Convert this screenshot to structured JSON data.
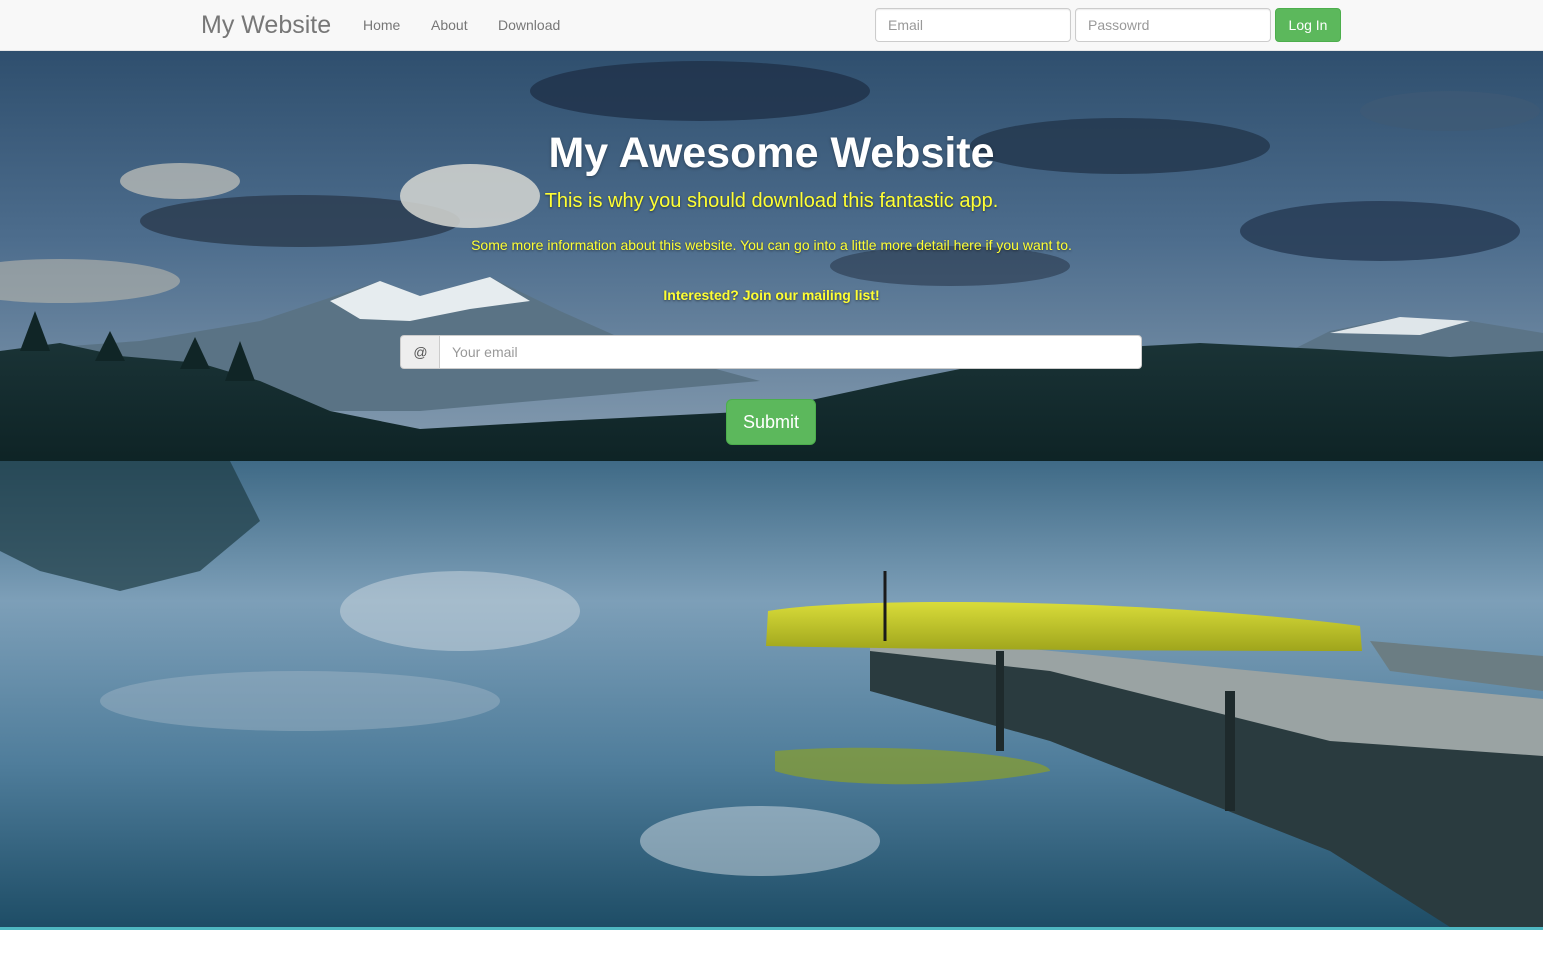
{
  "navbar": {
    "brand": "My Website",
    "links": [
      "Home",
      "About",
      "Download"
    ],
    "email_placeholder": "Email",
    "password_placeholder": "Passowrd",
    "login_label": "Log In"
  },
  "hero": {
    "title": "My Awesome Website",
    "subtitle": "This is why you should download this fantastic app.",
    "info": "Some more information about this website. You can go into a little more detail here if you want to.",
    "interest": "Interested? Join our mailing list!",
    "email_addon": "@",
    "email_placeholder": "Your email",
    "submit_label": "Submit"
  },
  "colors": {
    "accent_green": "#5cb85c",
    "hero_text_yellow": "#ffff33",
    "navbar_bg": "#f8f8f8"
  }
}
